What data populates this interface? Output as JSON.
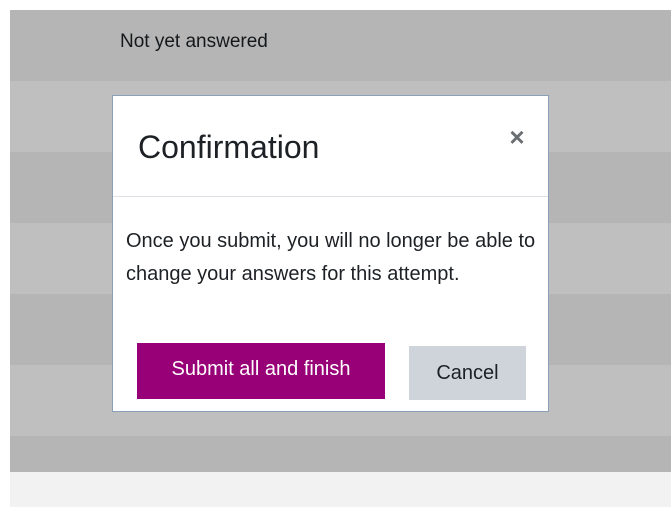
{
  "background": {
    "rows": [
      {
        "status_text": "Not yet answered"
      },
      {
        "status_text": ""
      },
      {
        "status_text": ""
      },
      {
        "status_text": ""
      },
      {
        "status_text": ""
      },
      {
        "status_text": ""
      },
      {
        "status_text": ""
      }
    ]
  },
  "dialog": {
    "title": "Confirmation",
    "close_glyph": "×",
    "body": "Once you submit, you will no longer be able to change your answers for this attempt.",
    "submit_label": "Submit all and finish",
    "cancel_label": "Cancel"
  },
  "colors": {
    "primary_button": "#980078",
    "secondary_button": "#ced4da",
    "dialog_border": "#8c9fb8"
  }
}
